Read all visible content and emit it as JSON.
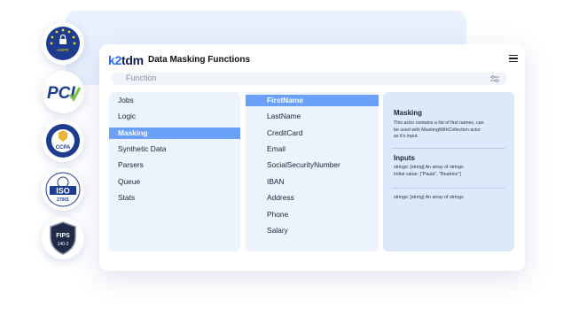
{
  "badges": [
    {
      "name": "gdpr",
      "text": "GDPR"
    },
    {
      "name": "pci",
      "text": "PCI"
    },
    {
      "name": "ccpa",
      "text": "CCPA"
    },
    {
      "name": "iso",
      "text": "ISO",
      "subtext": "27001"
    },
    {
      "name": "fips",
      "text": "FIPS",
      "subtext": "140-2"
    }
  ],
  "header": {
    "logo": "k2tdm",
    "logo_part1": "k",
    "logo_part2": "2",
    "logo_part3": "tdm",
    "title": "Data Masking Functions"
  },
  "search": {
    "label": "Function"
  },
  "categories": {
    "items": [
      "Jobs",
      "Logic",
      "Masking",
      "Synthetic Data",
      "Parsers",
      "Queue",
      "Stats"
    ],
    "selected": "Masking"
  },
  "functions": {
    "items": [
      "FirstName",
      "LastName",
      "CreditCard",
      "Email",
      "SocialSecurityNumber",
      "IBAN",
      "Address",
      "Phone",
      "Salary"
    ],
    "selected": "FirstName"
  },
  "details": {
    "heading": "Masking",
    "description_line1": "This actor contains a list of first names, can",
    "description_line2": "be used with MaskingWithCollection actor",
    "description_line3": "as it's input.",
    "inputs_heading": "Inputs",
    "input_line1": "strings: [string] An array of strings",
    "input_line2": "Initial value: [\"Paula\", \"Beatrice\"]",
    "output_line": "strings: [string] An array of strings"
  },
  "colors": {
    "accent": "#6aa0f5",
    "logo_accent": "#2a6df4",
    "panel_bg": "#ecf3fd",
    "detail_bg": "#dce9fb"
  }
}
